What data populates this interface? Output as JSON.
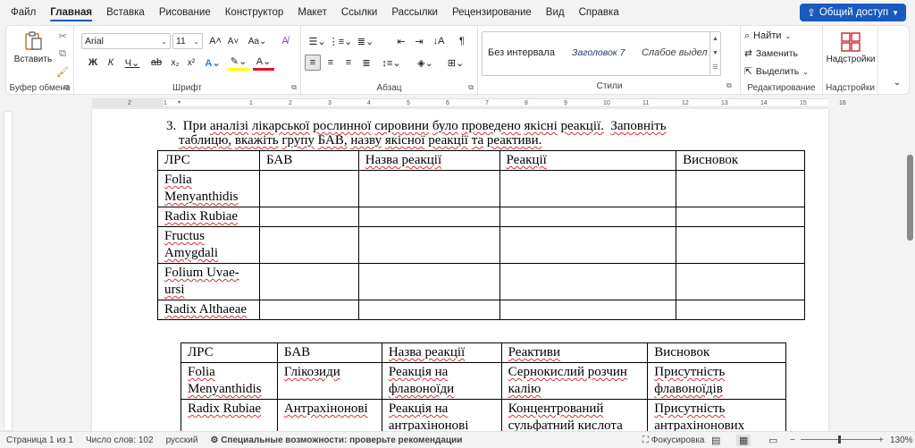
{
  "menu": {
    "tabs": [
      "Файл",
      "Главная",
      "Вставка",
      "Рисование",
      "Конструктор",
      "Макет",
      "Ссылки",
      "Рассылки",
      "Рецензирование",
      "Вид",
      "Справка"
    ],
    "share": "Общий доступ"
  },
  "ribbon": {
    "clipboard": {
      "paste": "Вставить",
      "label": "Буфер обмена"
    },
    "font": {
      "name": "Arial",
      "size": "11",
      "label": "Шрифт"
    },
    "paragraph": {
      "label": "Абзац"
    },
    "styles": {
      "items": [
        "Без интервала",
        "Заголовок 7",
        "Слабое выдел"
      ],
      "label": "Стили"
    },
    "editing": {
      "find": "Найти",
      "replace": "Заменить",
      "select": "Выделить",
      "label": "Редактирование"
    },
    "addins": {
      "button": "Надстройки",
      "label": "Надстройки"
    }
  },
  "ruler": {
    "ticks": [
      "2",
      "1",
      "1",
      "2",
      "3",
      "4",
      "5",
      "6",
      "7",
      "8",
      "9",
      "10",
      "11",
      "12",
      "13",
      "14",
      "15",
      "16"
    ]
  },
  "document": {
    "number": "3.",
    "task_words": [
      "При",
      "аналізі",
      "лікарської",
      "рослинної",
      "сировини",
      "було",
      "проведено",
      "якісні",
      "реакції.",
      "Заповніть",
      "таблицю,",
      "вкажіть",
      "групу",
      "БАВ,",
      "назву",
      "якісної",
      "реакції",
      "та",
      "реактиви."
    ],
    "table1": {
      "headers": [
        "ЛРС",
        "БАВ",
        "Назва реакції",
        "Реакції",
        "Висновок"
      ],
      "rows": [
        [
          "Folia Menyanthidis"
        ],
        [
          "Radix Rubiae"
        ],
        [
          "Fructus Amygdali"
        ],
        [
          "Folium  Uvae-ursi"
        ],
        [
          "Radix Althaeae"
        ]
      ]
    },
    "table2": {
      "headers": [
        "ЛРС",
        "БАВ",
        "Назва реакції",
        "Реактиви",
        "Висновок"
      ],
      "rows": [
        [
          "Folia Menyanthidis",
          "Глікозиди",
          "Реакція на флавоноїди",
          "Сернокислий розчин калію",
          "Присутність флавоноїдів"
        ],
        [
          "Radix Rubiae",
          "Антрахінонові",
          "Реакція на антрахінонові",
          "Концентрований сульфатний кислота",
          "Присутність антрахінонових сполук"
        ]
      ]
    }
  },
  "status": {
    "page": "Страница 1 из 1",
    "words": "Число слов: 102",
    "lang": "русский",
    "accessibility": "Специальные возможности: проверьте рекомендации",
    "focus": "Фокусировка",
    "zoom_minus": "−",
    "zoom_plus": "+",
    "zoom": "130%"
  },
  "colors": {
    "accent": "#185abd",
    "squiggle": "#d13438",
    "highlight": "#ffff00",
    "font_color": "#e81123"
  }
}
